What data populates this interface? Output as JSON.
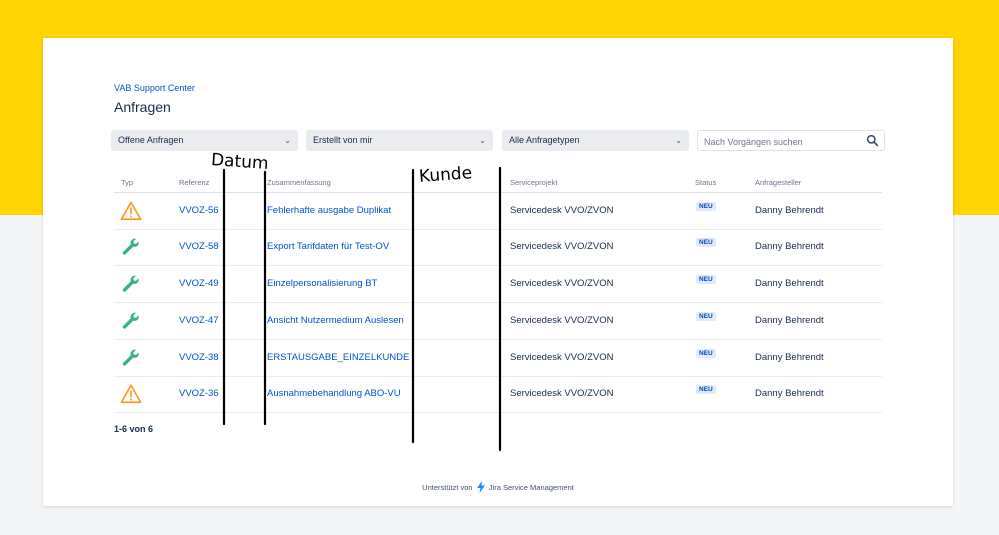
{
  "breadcrumb": "VAB Support Center",
  "title": "Anfragen",
  "filters": [
    {
      "label": "Offene Anfragen"
    },
    {
      "label": "Erstellt von mir"
    },
    {
      "label": "Alle Anfragetypen"
    }
  ],
  "search": {
    "placeholder": "Nach Vorgängen suchen"
  },
  "table": {
    "headers": [
      "Typ",
      "Referenz",
      "Zusammenfassung",
      "Serviceprojekt",
      "Status",
      "Anfragesteller"
    ],
    "rows": [
      {
        "type_icon": "warning-icon",
        "ref": "VVOZ-56",
        "summary": "Fehlerhafte ausgabe Duplikat",
        "project": "Servicedesk VVO/ZVON",
        "status": "NEU",
        "requester": "Danny Behrendt"
      },
      {
        "type_icon": "wrench-icon",
        "ref": "VVOZ-58",
        "summary": "Export Tarifdaten für Test-OV",
        "project": "Servicedesk VVO/ZVON",
        "status": "NEU",
        "requester": "Danny Behrendt"
      },
      {
        "type_icon": "wrench-icon",
        "ref": "VVOZ-49",
        "summary": "Einzelpersonalisierung BT",
        "project": "Servicedesk VVO/ZVON",
        "status": "NEU",
        "requester": "Danny Behrendt"
      },
      {
        "type_icon": "wrench-icon",
        "ref": "VVOZ-47",
        "summary": "Ansicht Nutzermedium Auslesen",
        "project": "Servicedesk VVO/ZVON",
        "status": "NEU",
        "requester": "Danny Behrendt"
      },
      {
        "type_icon": "wrench-icon",
        "ref": "VVOZ-38",
        "summary": "ERSTAUSGABE_EINZELKUNDE",
        "project": "Servicedesk VVO/ZVON",
        "status": "NEU",
        "requester": "Danny Behrendt"
      },
      {
        "type_icon": "warning-icon",
        "ref": "VVOZ-36",
        "summary": "Ausnahmebehandlung ABO-VU",
        "project": "Servicedesk VVO/ZVON",
        "status": "NEU",
        "requester": "Danny Behrendt"
      }
    ]
  },
  "pagination": "1-6 von 6",
  "footer": {
    "prefix": "Unterstützt von",
    "brand": "Jira Service Management"
  },
  "annotations": {
    "datum": "Datum",
    "kunde": "Kunde"
  },
  "colors": {
    "brand_yellow": "#ffd400",
    "link": "#0052cc",
    "badge_bg": "#deebff",
    "warning": "#ff991f",
    "wrench": "#36b37e"
  }
}
